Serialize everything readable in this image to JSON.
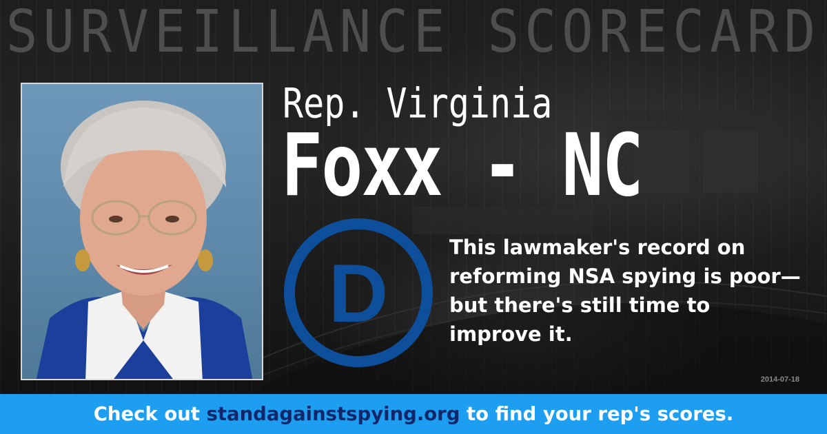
{
  "banner": {
    "title": "SURVEILLANCE SCORECARD"
  },
  "rep": {
    "prefix": "Rep. Virginia",
    "name_state": "Foxx - NC",
    "party_letter": "D"
  },
  "colors": {
    "party_blue": "#0e4f9c",
    "footer_bg": "#1e9ef0",
    "link_color": "#10276a",
    "banner_text": "#4e4e4e"
  },
  "record": {
    "text": "This lawmaker's record on reforming NSA spying is poor—but there's still time to improve it."
  },
  "date": "2014-07-18",
  "footer": {
    "prefix": "Check out ",
    "link": "standagainstspying.org",
    "suffix": " to find your rep's scores."
  },
  "photo": {
    "subject": "portrait-photo"
  }
}
